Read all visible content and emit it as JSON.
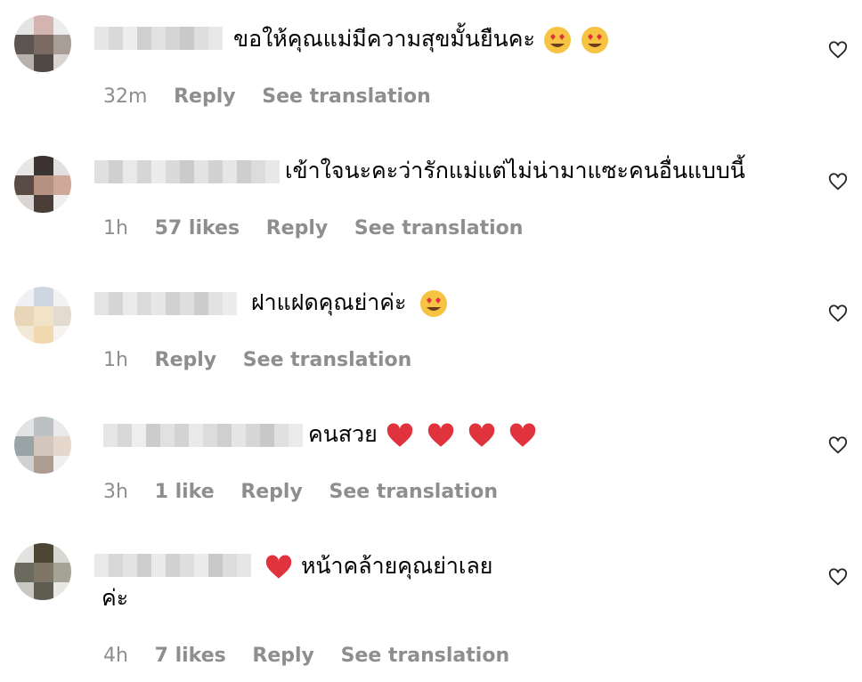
{
  "comments": [
    {
      "text": "ขอให้คุณแม่มีความสุขมั้นยืนคะ",
      "emojis": [
        "heart-eyes-emoji",
        "heart-eyes-emoji"
      ],
      "time": "32m",
      "likes": "",
      "reply": "Reply",
      "see_translation": "See translation"
    },
    {
      "text": "เข้าใจนะคะว่ารักแม่แต่ไม่น่ามาแซะคนอื่นแบบนี้",
      "emojis": [],
      "time": "1h",
      "likes": "57 likes",
      "reply": "Reply",
      "see_translation": "See translation"
    },
    {
      "text": "ฝาแฝดคุณย่าค่ะ",
      "emojis": [
        "heart-eyes-emoji"
      ],
      "time": "1h",
      "likes": "",
      "reply": "Reply",
      "see_translation": "See translation"
    },
    {
      "text": "คนสวย",
      "emojis": [
        "red-heart-emoji",
        "red-heart-emoji",
        "red-heart-emoji",
        "red-heart-emoji"
      ],
      "time": "3h",
      "likes": "1 like",
      "reply": "Reply",
      "see_translation": "See translation"
    },
    {
      "text": "หน้าคล้ายคุณย่าเลย",
      "text_line2": "ค่ะ",
      "emojis_before": [
        "red-heart-emoji"
      ],
      "time": "4h",
      "likes": "7 likes",
      "reply": "Reply",
      "see_translation": "See translation"
    }
  ],
  "colors": {
    "meta": "#8e8e8e",
    "emoji_face": "#f6c343",
    "emoji_heart": "#e0333d",
    "like_icon": "#262626"
  },
  "icons": {
    "like_button": "heart-outline-icon"
  }
}
